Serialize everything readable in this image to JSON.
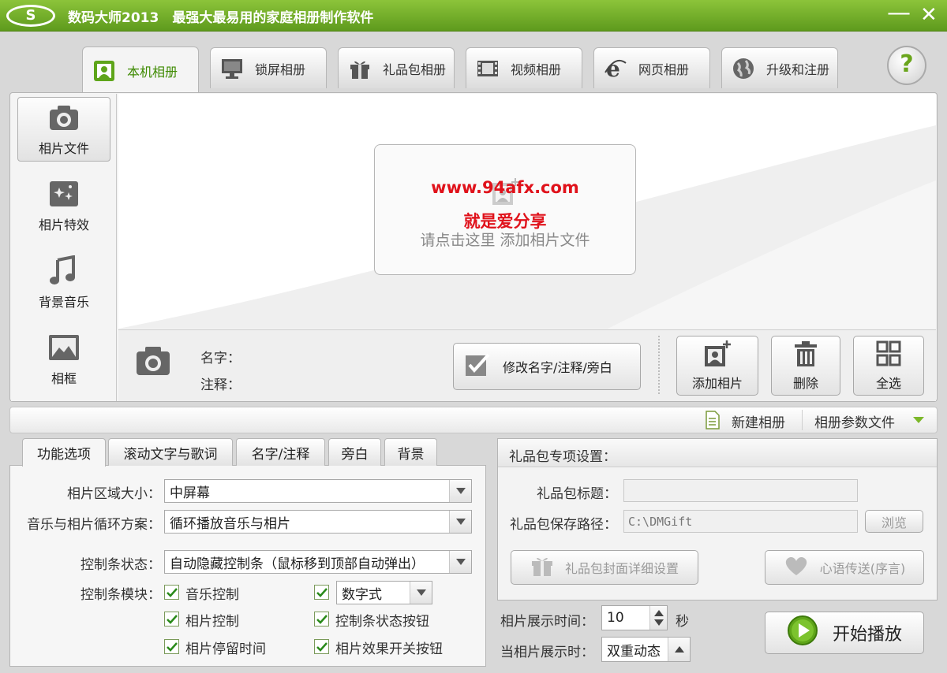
{
  "app": {
    "logo_text": "S",
    "title": "数码大师2013　最强大最易用的家庭相册制作软件",
    "minimize": "—",
    "close": "✕"
  },
  "top_tabs": [
    {
      "label": "本机相册",
      "icon": "photo-frame-icon",
      "active": true
    },
    {
      "label": "锁屏相册",
      "icon": "monitor-icon",
      "active": false
    },
    {
      "label": "礼品包相册",
      "icon": "gift-icon",
      "active": false
    },
    {
      "label": "视频相册",
      "icon": "film-icon",
      "active": false
    },
    {
      "label": "网页相册",
      "icon": "ie-icon",
      "active": false
    },
    {
      "label": "升级和注册",
      "icon": "globe-icon",
      "active": false
    }
  ],
  "help": {
    "label": "?"
  },
  "sidebar": {
    "items": [
      {
        "label": "相片文件",
        "icon": "camera-icon",
        "selected": true
      },
      {
        "label": "相片特效",
        "icon": "sparkle-icon",
        "selected": false
      },
      {
        "label": "背景音乐",
        "icon": "music-note-icon",
        "selected": false
      },
      {
        "label": "相框",
        "icon": "frame-icon",
        "selected": false
      }
    ]
  },
  "canvas": {
    "hint": "请点击这里  添加相片文件",
    "watermark_url": "www.94afx.com",
    "watermark_text": "就是爱分享"
  },
  "info": {
    "name_label": "名字：",
    "note_label": "注释：",
    "edit_button": "修改名字/注释/旁白",
    "add_photo": "添加相片",
    "delete": "删除",
    "select_all": "全选"
  },
  "strip": {
    "new_album": "新建相册",
    "album_params": "相册参数文件"
  },
  "bottom_tabs": [
    {
      "label": "功能选项",
      "active": true
    },
    {
      "label": "滚动文字与歌词",
      "active": false
    },
    {
      "label": "名字/注释",
      "active": false
    },
    {
      "label": "旁白",
      "active": false
    },
    {
      "label": "背景",
      "active": false
    }
  ],
  "options": {
    "area_size_label": "相片区域大小：",
    "area_size_value": "中屏幕",
    "loop_label": "音乐与相片循环方案：",
    "loop_value": "循环播放音乐与相片",
    "bar_state_label": "控制条状态：",
    "bar_state_value": "自动隐藏控制条（鼠标移到顶部自动弹出）",
    "bar_module_label": "控制条模块：",
    "modules": [
      {
        "label": "音乐控制",
        "checked": true
      },
      {
        "label": "相片控制",
        "checked": true
      },
      {
        "label": "相片停留时间",
        "checked": true
      },
      {
        "label": "控制条状态按钮",
        "checked": true
      },
      {
        "label": "相片效果开关按钮",
        "checked": true
      }
    ],
    "numeric_checked": true,
    "numeric_value": "数字式"
  },
  "gift": {
    "header": "礼品包专项设置：",
    "title_label": "礼品包标题：",
    "title_value": "",
    "path_label": "礼品包保存路径：",
    "path_value": "C:\\DMGift",
    "browse": "浏览",
    "cover_button": "礼品包封面详细设置",
    "message_button": "心语传送(序言)"
  },
  "playback": {
    "duration_label": "相片展示时间：",
    "duration_value": "10",
    "duration_unit": "秒",
    "show_label": "当相片展示时：",
    "show_value": "双重动态",
    "start_button": "开始播放"
  },
  "colors": {
    "accent_green": "#6aa51c",
    "title_green": "#5e9a1d",
    "watermark_red": "#e0121b"
  }
}
